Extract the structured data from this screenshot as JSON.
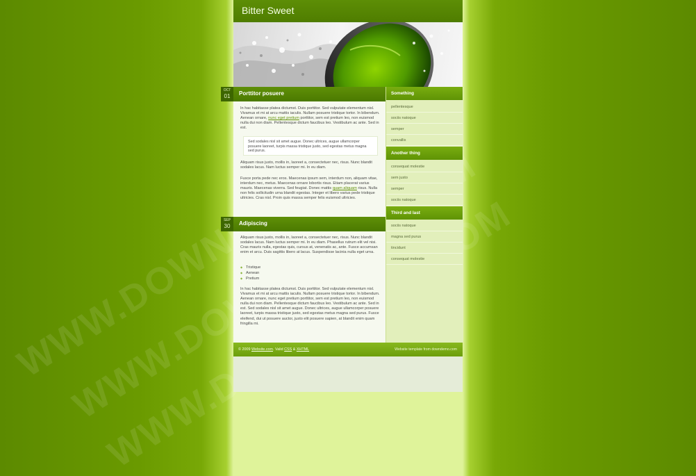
{
  "site": {
    "title": "Bitter Sweet"
  },
  "watermark": {
    "text": "WWW.DOWNDEMO.COM"
  },
  "posts": [
    {
      "month": "OCT",
      "day": "01",
      "title": "Porttitor posuere",
      "p1_a": "In hac habitasse platea dictumst. Duis porttitor. Sed vulputate elementum nisl. Vivamus et mi at arcu mattis iaculis. Nullam posuere tristique tortor. In bibendum. Aenean ornare, ",
      "p1_link": "nunc eget pretium",
      "p1_b": " porttitor, sem est pretium leo, non euismod nulla dui non diam. Pellentesque dictum faucibus leo. Vestibulum ac ante. Sed in est.",
      "quote": "Sed sodales nisl sit amet augue. Donec ultrices, augue ullamcorper posuere laoreet, turpis massa tristique justo, sed egestas metus magna sed purus.",
      "p2": "Aliquam risus justo, mollis in, laoreet a, consectetuer nec, risus. Nunc blandit sodales lacus. Nam luctus semper mi. In eu diam.",
      "p3_a": "Fusce porta pede nec eros. Maecenas ipsum sem, interdum non, aliquam vitae, interdum nec, metus. Maecenas ornare lobortis risus. Etiam placerat varius mauris. Maecenas viverra. Sed feugiat. Donec mattis ",
      "p3_link": "quam aliquam",
      "p3_b": " risus. Nulla non felis sollicitudin urna blandit egestas. Integer et libero varius pede tristique ultricies. Cras nisl. Proin quis massa semper felis euismod ultricies."
    },
    {
      "month": "SEP",
      "day": "30",
      "title": "Adipiscing",
      "p1": "Aliquam risus justo, mollis in, laoreet a, consectetuer nec, risus. Nunc blandit sodales lacus. Nam luctus semper mi. In eu diam. Phasellus rutrum elit vel nisi. Cras mauris nulla, egestas quis, cursus at, venenatis ac, ante. Fusce accumsan enim et arcu. Duis sagittis libero at lacus. Suspendisse lacinia nulla eget urna.",
      "list": [
        "Tristique",
        "Aenean",
        "Pretium"
      ],
      "p2": "In hac habitasse platea dictumst. Duis porttitor. Sed vulputate elementum nisl. Vivamus et mi at arcu mattis iaculis. Nullam posuere tristique tortor. In bibendum. Aenean ornare, nunc eget pretium porttitor, sem est pretium leo, non euismod nulla dui non diam. Pellentesque dictum faucibus leo. Vestibulum ac ante. Sed in est. Sed sodales nisl sit amet augue. Donec ultrices, augue ullamcorper posuere laoreet, turpis massa tristique justo, sed egestas metus magna sed purus. Fusce eleifend, dui ut posuere auctor, justo elit posuere sapien, at blandit enim quam fringilla mi."
    }
  ],
  "sidebar": [
    {
      "title": "Something",
      "items": [
        "pellentesque",
        "sociis natoque",
        "semper",
        "convallis"
      ]
    },
    {
      "title": "Another thing",
      "items": [
        "consequat molestie",
        "sem justo",
        "semper",
        "sociis natoque"
      ]
    },
    {
      "title": "Third and last",
      "items": [
        "sociis natoque",
        "magna sed purus",
        "tincidunt",
        "consequat molestie"
      ]
    }
  ],
  "footer": {
    "copyright": "© 2009",
    "site_link": "Website.com",
    "valid_text": ". Valid",
    "css_link": "CSS",
    "amp": "&",
    "xhtml_link": "XHTML",
    "credit": "Website template from downdemo.com"
  }
}
